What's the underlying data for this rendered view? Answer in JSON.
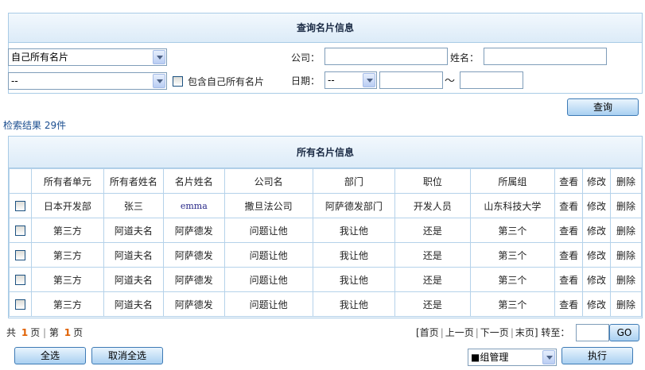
{
  "search": {
    "title": "查询名片信息",
    "scope_select": "自己所有名片",
    "group_select": "--",
    "include_own_label": "包含自己所有名片",
    "company_label": "公司：",
    "name_label": "姓名：",
    "date_label": "日期：",
    "date_select": "--",
    "date_separator": "～",
    "query_button": "查询"
  },
  "result_count": "检索结果 29件",
  "list": {
    "title": "所有名片信息",
    "columns": [
      "所有者单元",
      "所有者姓名",
      "名片姓名",
      "公司名",
      "部门",
      "职位",
      "所属组",
      "查看",
      "修改",
      "删除"
    ],
    "rows": [
      [
        "日本开发部",
        "张三",
        "emma",
        "撒旦法公司",
        "阿萨德发部门",
        "开发人员",
        "山东科技大学",
        "查看",
        "修改",
        "删除"
      ],
      [
        "第三方",
        "阿道夫名",
        "阿萨德发",
        "问题让他",
        "我让他",
        "还是",
        "第三个",
        "查看",
        "修改",
        "删除"
      ],
      [
        "第三方",
        "阿道夫名",
        "阿萨德发",
        "问题让他",
        "我让他",
        "还是",
        "第三个",
        "查看",
        "修改",
        "删除"
      ],
      [
        "第三方",
        "阿道夫名",
        "阿萨德发",
        "问题让他",
        "我让他",
        "还是",
        "第三个",
        "查看",
        "修改",
        "删除"
      ],
      [
        "第三方",
        "阿道夫名",
        "阿萨德发",
        "问题让他",
        "我让他",
        "还是",
        "第三个",
        "查看",
        "修改",
        "删除"
      ]
    ]
  },
  "pager": {
    "total_prefix": "共",
    "total_pages": "1",
    "total_suffix": "页",
    "current_prefix": "第",
    "current_page": "1",
    "current_suffix": "页",
    "first": "[首页",
    "prev": "上一页",
    "next": "下一页",
    "last": "末页]",
    "jump_label": "转至：",
    "go_button": "GO"
  },
  "footer": {
    "select_all": "全选",
    "deselect_all": "取消全选",
    "group_manage": "■组管理",
    "execute": "执行"
  }
}
